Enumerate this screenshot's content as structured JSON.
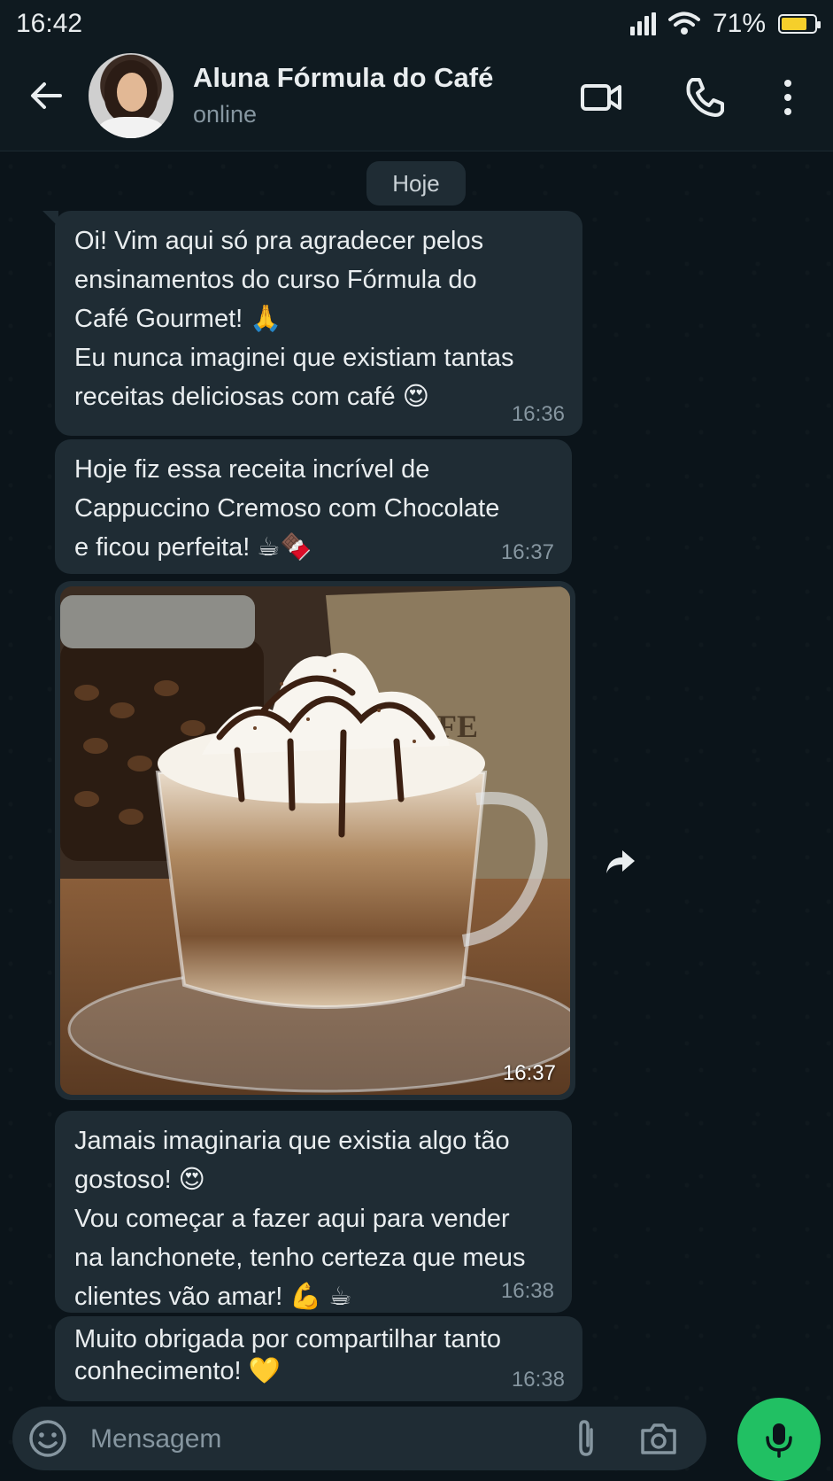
{
  "status_bar": {
    "time": "16:42",
    "battery": "71%",
    "battery_level": 0.71
  },
  "header": {
    "contact_name": "Aluna Fórmula do Café",
    "contact_status": "online",
    "icons": [
      "back-arrow-icon",
      "video-call-icon",
      "phone-icon",
      "more-options-icon"
    ]
  },
  "chat": {
    "date_chip": "Hoje",
    "messages": [
      {
        "text": "Oi! Vim aqui só pra agradecer pelos\nensinamentos do curso Fórmula do\nCafé Gourmet! 🙏\nEu nunca imaginei que existiam tantas\nreceitas deliciosas com café 😍",
        "time": "16:36"
      },
      {
        "text": "Hoje fiz essa receita incrível de\nCappuccino Cremoso com Chocolate\ne ficou perfeita! ☕🍫",
        "time": "16:37"
      },
      {
        "type": "image",
        "time": "16:37"
      },
      {
        "text": "Jamais imaginaria que existia algo tão\ngostoso! 😍\nVou começar a fazer aqui para vender\nna lanchonete, tenho certeza que meus\nclientes vão amar! 💪 ☕",
        "time": "16:38"
      },
      {
        "text": "Muito obrigada por compartilhar tanto\nconhecimento! 💛",
        "time": "16:38"
      }
    ]
  },
  "input_bar": {
    "placeholder": "Mensagem",
    "value": ""
  },
  "colors": {
    "background": "#0b141a",
    "bubble": "#1f2c34",
    "accent": "#21c063",
    "muted_text": "#8696a0"
  }
}
